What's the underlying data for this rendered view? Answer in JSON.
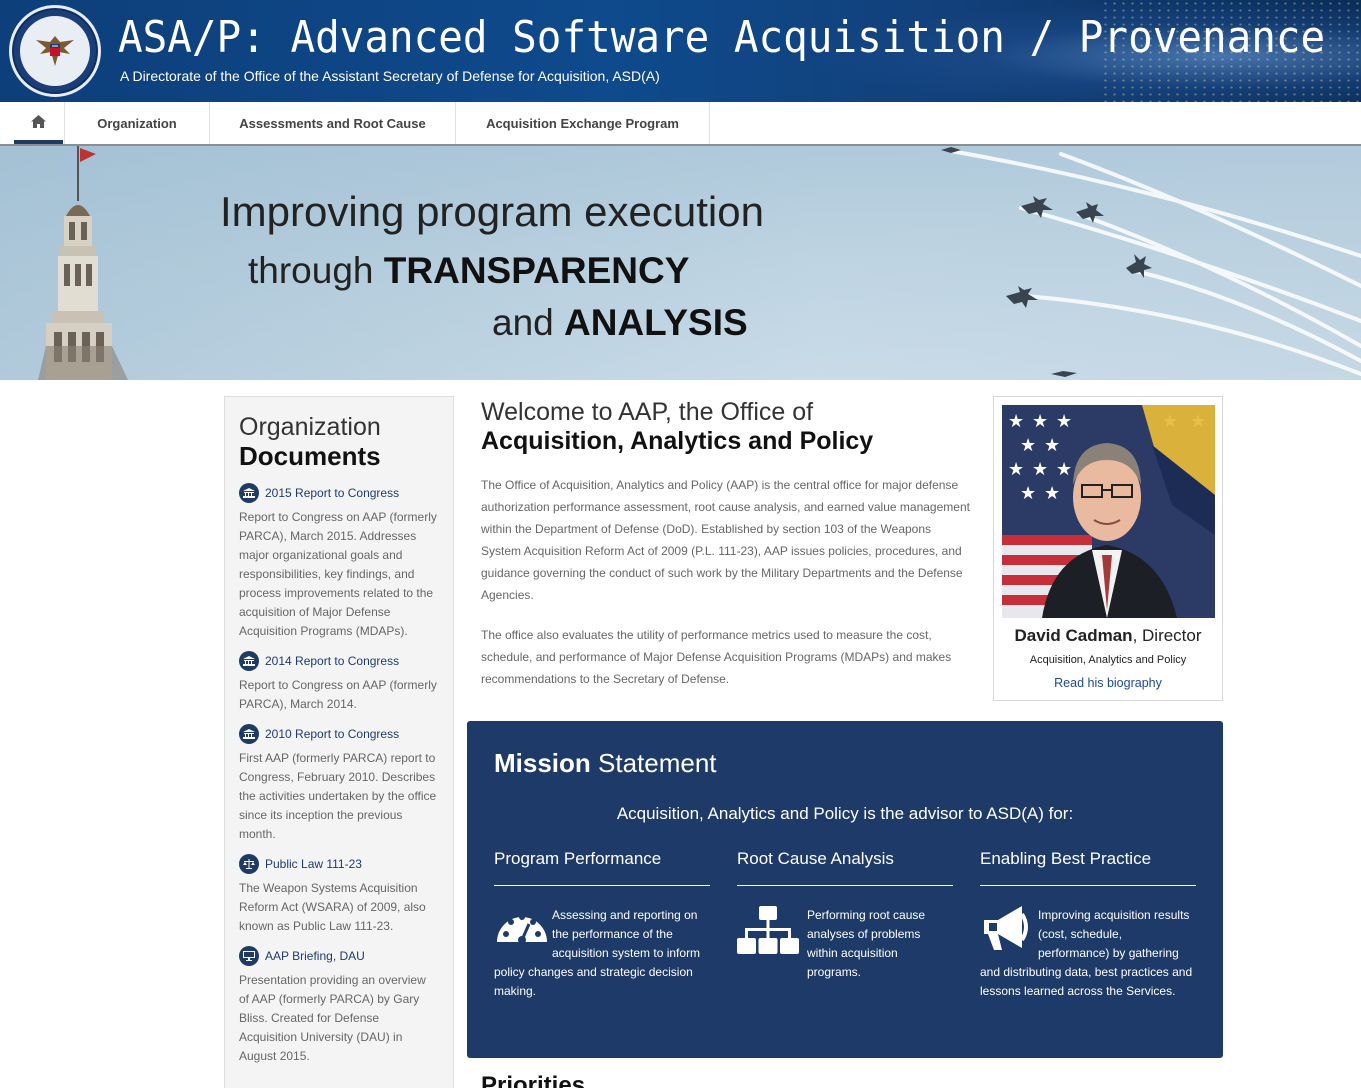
{
  "header": {
    "title": "ASA/P: Advanced Software Acquisition / Provenance",
    "subtitle": "A Directorate of the Office of the Assistant Secretary of Defense for Acquisition, ASD(A)",
    "seal_icon": "dod-seal-icon"
  },
  "nav": {
    "home_icon": "home-icon",
    "items": [
      "Organization",
      "Assessments and Root Cause",
      "Acquisition Exchange Program"
    ]
  },
  "hero": {
    "line1": "Improving program execution",
    "line2_pre": "through ",
    "line2_bold": "TRANSPARENCY",
    "line3_pre": "and ",
    "line3_bold": "ANALYSIS"
  },
  "sidebar": {
    "title_light": "Organization",
    "title_bold": "Documents",
    "docs": [
      {
        "icon": "building-icon",
        "title": "2015 Report to Congress",
        "desc": "Report to Congress on AAP (formerly PARCA), March 2015. Addresses major organizational goals and responsibilities, key findings, and process improvements related to the acquisition of Major Defense Acquisition Programs (MDAPs)."
      },
      {
        "icon": "building-icon",
        "title": "2014 Report to Congress",
        "desc": "Report to Congress on AAP (formerly PARCA), March 2014."
      },
      {
        "icon": "building-icon",
        "title": "2010 Report to Congress",
        "desc": "First AAP (formerly PARCA) report to Congress, February 2010. Describes the activities undertaken by the office since its inception the previous month."
      },
      {
        "icon": "scales-icon",
        "title": "Public Law 111-23",
        "desc": "The Weapon Systems Acquisition Reform Act (WSARA) of 2009, also known as Public Law 111-23."
      },
      {
        "icon": "monitor-icon",
        "title": "AAP Briefing, DAU",
        "desc": "Presentation providing an overview of AAP (formerly PARCA) by Gary Bliss. Created for Defense Acquisition University (DAU) in August 2015."
      }
    ]
  },
  "main": {
    "welcome_light": "Welcome to AAP, the Office of",
    "welcome_bold": "Acquisition, Analytics and Policy",
    "para1": "The Office of Acquisition, Analytics and Policy (AAP) is the central office for major defense authorization performance assessment, root cause analysis, and earned value management within the Department of Defense (DoD). Established by section 103 of the Weapons System Acquisition Reform Act of 2009 (P.L. 111-23), AAP issues policies, procedures, and guidance governing the conduct of such work by the Military Departments and the Defense Agencies.",
    "para2": "The office also evaluates the utility of performance metrics used to measure the cost, schedule, and performance of Major Defense Acquisition Programs (MDAPs) and makes recommendations to the Secretary of Defense."
  },
  "director": {
    "name_bold": "David Cadman",
    "name_rest": ", Director",
    "org": "Acquisition, Analytics and Policy",
    "link": "Read his biography"
  },
  "mission": {
    "title_bold": "Mission",
    "title_light": " Statement",
    "subtitle": "Acquisition, Analytics and Policy is the advisor to ASD(A) for:",
    "columns": [
      {
        "title": "Program Performance",
        "icon": "gauge-icon",
        "text": "Assessing and reporting on the performance of the acquisition system to inform policy changes and strategic decision making."
      },
      {
        "title": "Root Cause Analysis",
        "icon": "org-chart-icon",
        "text": "Performing root cause analyses of problems within acquisition programs."
      },
      {
        "title": "Enabling Best Practice",
        "icon": "megaphone-icon",
        "text": "Improving acquisition results (cost, schedule, performance) by gathering and distributing data, best practices and lessons learned across the Services."
      }
    ]
  },
  "priorities_heading": "Priorities",
  "colors": {
    "header_blue": "#0e4a8c",
    "mission_blue": "#1e3a68",
    "link_blue": "#1f4a8a",
    "nav_active": "#1f3a63"
  }
}
